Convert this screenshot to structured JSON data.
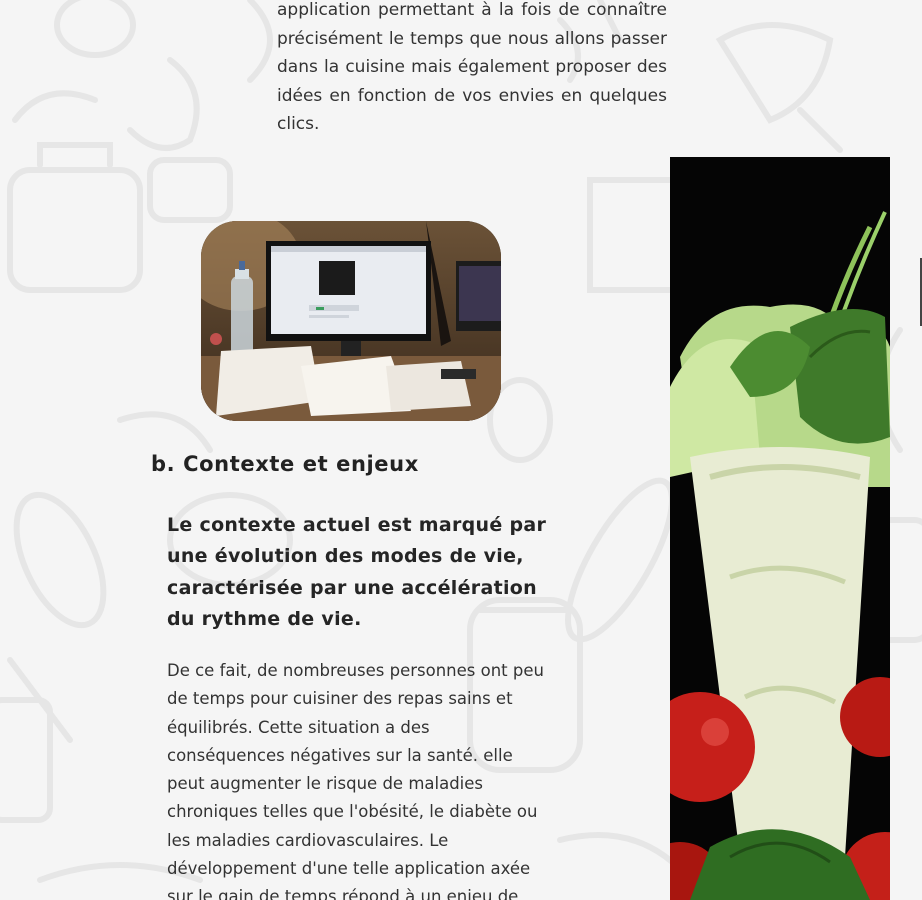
{
  "intro": {
    "text": "application permettant à la fois de connaître précisément le temps que nous allons passer dans la cuisine mais également proposer des idées en fonction de vos envies en quelques clics."
  },
  "section": {
    "heading": "b. Contexte et enjeux",
    "lead": "Le contexte actuel est marqué par une évolution des modes de vie, caractérisée par une accélération du rythme de vie.",
    "body": "De ce fait, de nombreuses personnes ont peu de temps pour cuisiner des repas sains et équilibrés. Cette situation a des conséquences négatives sur la santé. elle peut augmenter le risque de maladies chroniques telles que l'obésité, le diabète ou les maladies cardiovasculaires. Le développement d'une telle application axée sur le gain de temps répond à un enjeu de"
  },
  "colors": {
    "background": "#f5f5f5",
    "pattern": "#e6e6e6",
    "text": "#2a2a2a"
  }
}
